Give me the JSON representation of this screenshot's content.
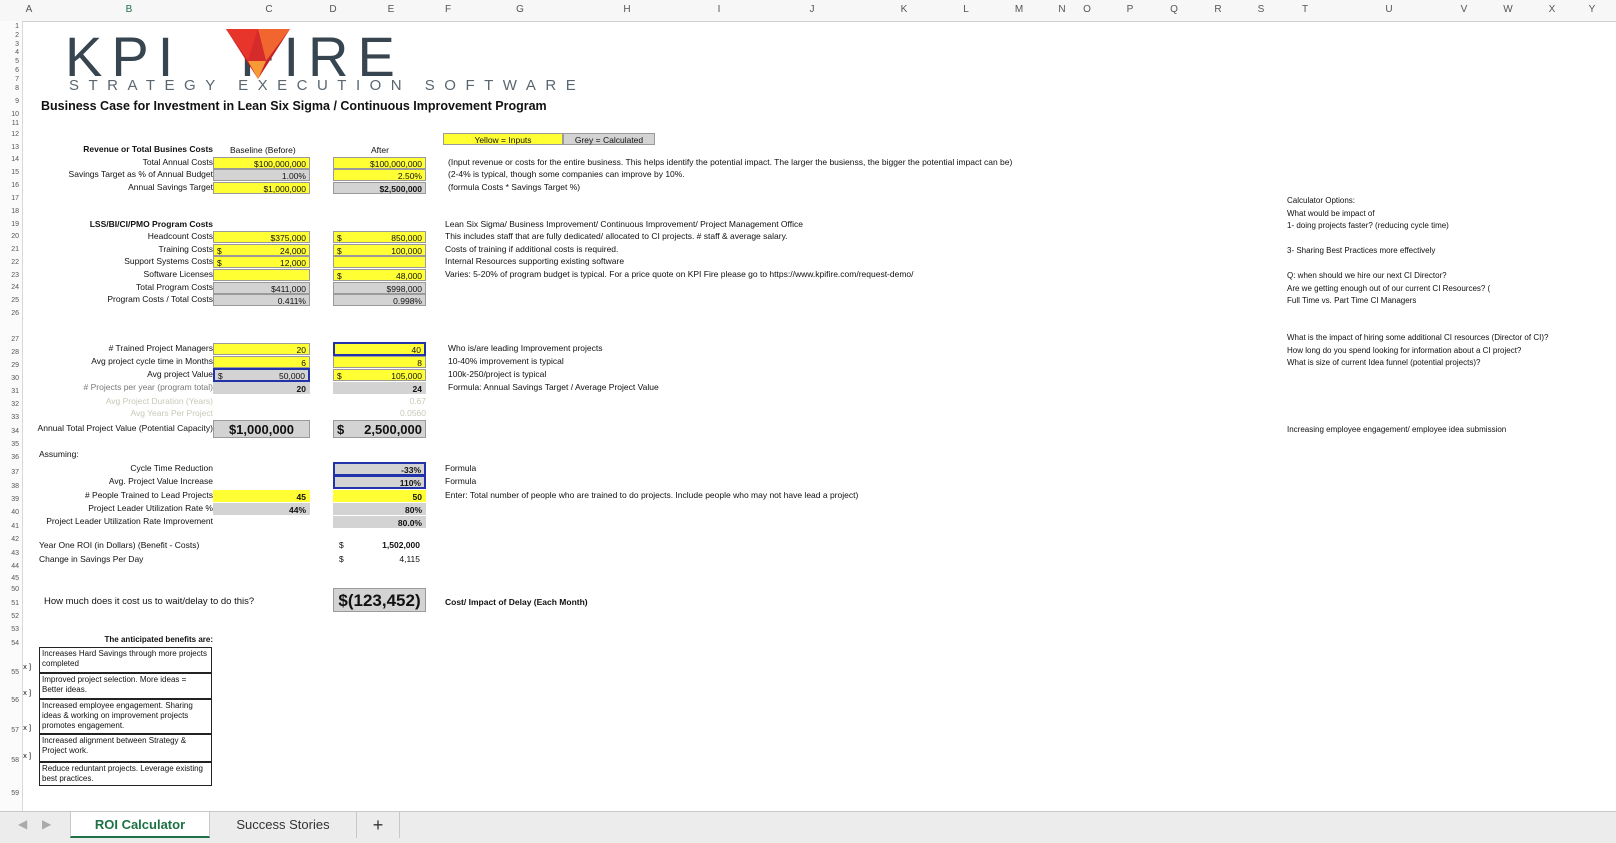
{
  "columns": [
    "A",
    "B",
    "C",
    "D",
    "E",
    "F",
    "G",
    "H",
    "I",
    "J",
    "K",
    "L",
    "M",
    "N",
    "O",
    "P",
    "Q",
    "R",
    "S",
    "T",
    "U",
    "V",
    "W",
    "X",
    "Y"
  ],
  "rows": [
    "1",
    "2",
    "3",
    "4",
    "5",
    "6",
    "7",
    "8",
    "9",
    "10",
    "11",
    "12",
    "13",
    "14",
    "15",
    "16",
    "17",
    "18",
    "19",
    "20",
    "21",
    "22",
    "23",
    "24",
    "25",
    "26",
    "27",
    "28",
    "29",
    "30",
    "31",
    "32",
    "33",
    "34",
    "35",
    "36",
    "37",
    "38",
    "39",
    "40",
    "41",
    "42",
    "43",
    "44",
    "45",
    "50",
    "51",
    "52",
    "53",
    "54",
    "55",
    "56",
    "57",
    "58",
    "59"
  ],
  "logo": {
    "brand": "KPI FIRE",
    "tagline": "STRATEGY EXECUTION SOFTWARE",
    "flame_colors": [
      "#e8352b",
      "#f0662e",
      "#f79a36",
      "#c4202a"
    ]
  },
  "title": "Business Case for Investment in Lean Six Sigma / Continuous Improvement Program",
  "legend": {
    "inputs": "Yellow = Inputs",
    "calculated": "Grey = Calculated"
  },
  "revenue": {
    "header": "Revenue or Total Busines Costs",
    "baseline_hdr": "Baseline (Before)",
    "after_hdr": "After",
    "rows": [
      {
        "label": "Total Annual Costs",
        "before": "$100,000,000",
        "after": "$100,000,000",
        "note": "(Input revenue or costs for the entire business. This helps identify the potential impact.  The larger the busienss, the bigger the potential impact can be)"
      },
      {
        "label": "Savings Target as % of Annual Budget",
        "before": "1.00%",
        "after": "2.50%",
        "note": "(2-4% is typical, though some companies can improve by 10%."
      },
      {
        "label": "Annual Savings Target",
        "before": "$1,000,000",
        "after": "$2,500,000",
        "note": "(formula Costs * Savings Target %)"
      }
    ]
  },
  "program": {
    "header": "LSS/BI/CI/PMO Program Costs",
    "header_note": "Lean Six Sigma/ Business Improvement/ Continuous Improvement/ Project Management Office",
    "rows": [
      {
        "label": "Headcount Costs",
        "before": "$375,000",
        "after": "850,000",
        "note": "This includes staff that are fully dedicated/ allocated to CI projects.  # staff & average salary."
      },
      {
        "label": "Training Costs",
        "before": "24,000",
        "after": "100,000",
        "note": "Costs of training if additional costs is required."
      },
      {
        "label": "Support Systems Costs",
        "before": "12,000",
        "after": "",
        "note": "Internal Resources supporting existing software"
      },
      {
        "label": "Software Licenses",
        "before": "",
        "after": "48,000",
        "note": "Varies: 5-20% of program budget is typical. For a price quote on KPI Fire please go to https://www.kpifire.com/request-demo/"
      },
      {
        "label": "Total Program Costs",
        "before": "$411,000",
        "after": "$998,000",
        "note": ""
      },
      {
        "label": "Program Costs / Total Costs",
        "before": "0.411%",
        "after": "0.998%",
        "note": ""
      }
    ]
  },
  "projects": {
    "rows": [
      {
        "label": "# Trained Project Managers",
        "before": "20",
        "after": "40",
        "note": "Who is/are leading Improvement projects"
      },
      {
        "label": "Avg project cycle time in Months",
        "before": "6",
        "after": "8",
        "note": "10-40% improvement is typical"
      },
      {
        "label": "Avg project Value",
        "before": "50,000",
        "after": "105,000",
        "note": "100k-250/project is typical"
      },
      {
        "label": "# Projects per year (program total)",
        "before": "20",
        "after": "24",
        "note": "Formula: Annual Savings Target / Average Project Value"
      }
    ],
    "faint1": "Avg Project Duration (Years)",
    "faint1_val": "0.67",
    "faint2": "Avg Years Per Project",
    "faint2_val": "0.0560",
    "total_label": "Annual Total Project Value (Potential Capacity)",
    "total_before": "$1,000,000",
    "total_after": "2,500,000"
  },
  "assuming": {
    "header": "Assuming:",
    "rows": [
      {
        "label": "Cycle Time Reduction",
        "before": "",
        "after": "-33%",
        "note": "Formula"
      },
      {
        "label": "Avg. Project Value Increase",
        "before": "",
        "after": "110%",
        "note": "Formula"
      },
      {
        "label": "# People Trained to Lead Projects",
        "before": "45",
        "after": "50",
        "note": "Enter: Total number of people who are trained to do projects. Include people who may not have lead a project)"
      },
      {
        "label": "Project Leader Utilization Rate %",
        "before": "44%",
        "after": "80%",
        "note": ""
      },
      {
        "label": "Project Leader Utilization Rate Improvement",
        "before": "",
        "after": "80.0%",
        "note": ""
      }
    ]
  },
  "roi": {
    "label1": "Year One ROI (in Dollars)  (Benefit - Costs)",
    "val1": "1,502,000",
    "label2": "Change in Savings Per Day",
    "val2": "4,115"
  },
  "delay": {
    "question": "How much does it cost us to wait/delay to do this?",
    "value": "$(123,452)",
    "note": "Cost/ Impact of Delay (Each Month)"
  },
  "benefits": {
    "header": "The anticipated benefits are:",
    "items": [
      {
        "check": "[ x ]",
        "text": "Increases Hard Savings through more projects completed"
      },
      {
        "check": "[ x ]",
        "text": "Improved project selection. More ideas = Better ideas."
      },
      {
        "check": "[ x ]",
        "text": "Increased employee engagement. Sharing ideas & working on improvement projects promotes engagement."
      },
      {
        "check": "[ x ]",
        "text": "Increased alignment between Strategy & Project work."
      },
      {
        "check": "",
        "text": "Reduce reduntant projects. Leverage existing best practices."
      }
    ]
  },
  "sidebar_notes": [
    "Calculator Options:",
    "What would be impact of",
    "1- doing projects faster? (reducing cycle time)",
    "3- Sharing Best Practices more effectively",
    "Q: when should we hire our next CI Director?",
    "Are we getting enough out of our current CI Resources? (",
    "Full Time vs. Part Time CI Managers",
    "What is the impact of hiring some additional CI resources (Director of CI)?",
    "How long do you spend looking for information about a CI project?",
    "What is size of current Idea funnel (potential projects)?",
    "Increasing employee engagement/ employee idea submission"
  ],
  "currency": "$",
  "tabs": [
    "ROI Calculator",
    "Success Stories"
  ],
  "add_sheet": "+",
  "nav": {
    "prev": "◀",
    "next": "▶"
  }
}
